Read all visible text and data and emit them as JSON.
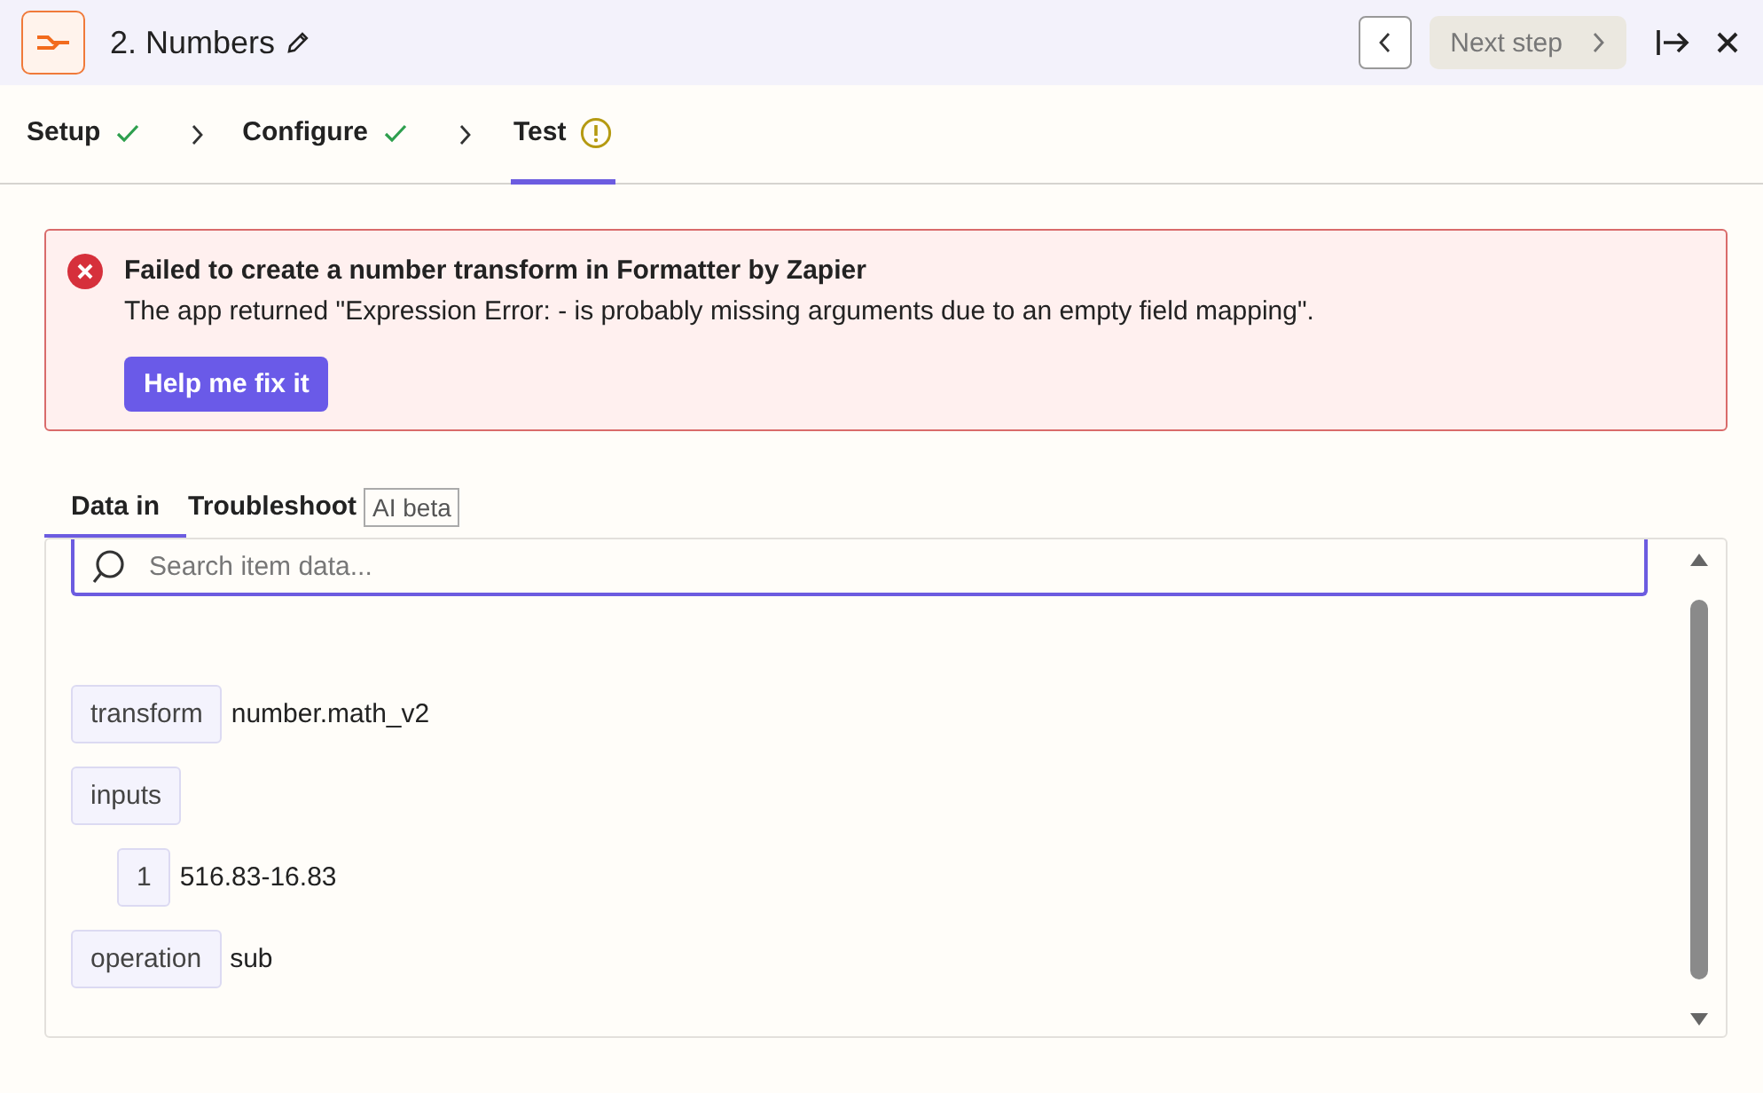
{
  "header": {
    "title": "2. Numbers",
    "next_button": "Next step"
  },
  "steps": [
    {
      "label": "Setup",
      "kind": "done",
      "selected": false
    },
    {
      "label": "Configure",
      "kind": "done",
      "selected": false
    },
    {
      "label": "Test",
      "kind": "warning",
      "selected": true
    }
  ],
  "alert": {
    "title": "Failed to create a number transform in Formatter by Zapier",
    "message": "The app returned \"Expression Error: - is probably missing arguments due to an empty field mapping\".",
    "button": "Help me fix it"
  },
  "data_tabs": [
    {
      "label": "Data in",
      "selected": true
    },
    {
      "label": "Troubleshoot",
      "badge": "AI beta",
      "selected": false
    }
  ],
  "search": {
    "placeholder": "Search item data..."
  },
  "items": [
    {
      "key": "transform",
      "value": "number.math_v2"
    },
    {
      "key": "inputs",
      "children": [
        {
          "key": "1",
          "value": "516.83-16.83"
        }
      ]
    },
    {
      "key": "operation",
      "value": "sub"
    }
  ]
}
